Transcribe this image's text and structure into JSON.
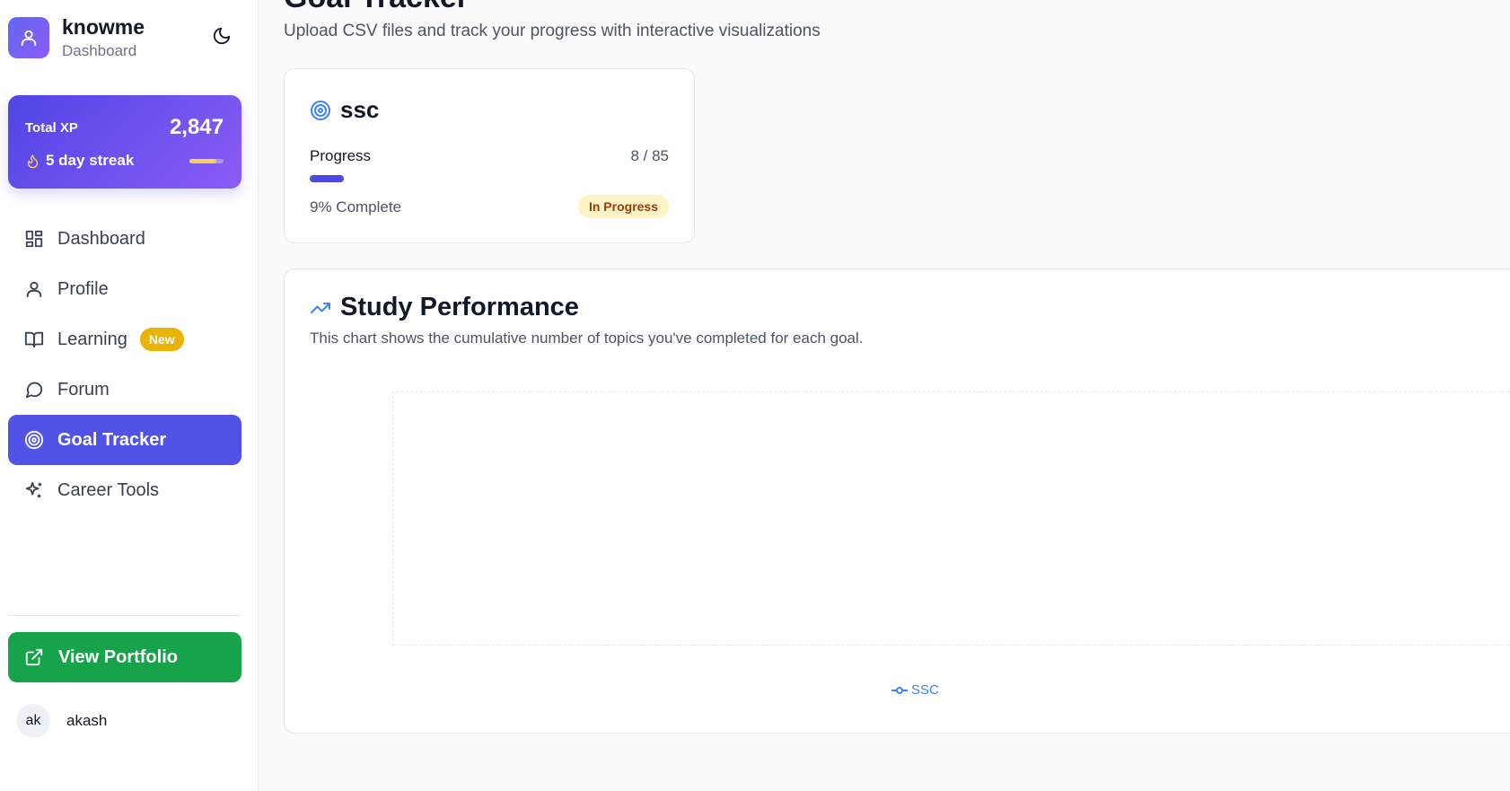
{
  "sidebar": {
    "brand": {
      "title": "knowme",
      "subtitle": "Dashboard",
      "logo_icon": "user-icon"
    },
    "theme_toggle_icon": "moon-icon",
    "xp": {
      "label": "Total XP",
      "value": "2,847",
      "streak": "5 day streak",
      "streak_level": 0.8
    },
    "nav": [
      {
        "label": "Dashboard",
        "icon": "dashboard-grid-icon",
        "active": false
      },
      {
        "label": "Profile",
        "icon": "user-icon",
        "active": false
      },
      {
        "label": "Learning",
        "icon": "book-open-icon",
        "active": false,
        "badge": "New"
      },
      {
        "label": "Forum",
        "icon": "message-circle-icon",
        "active": false
      },
      {
        "label": "Goal Tracker",
        "icon": "target-icon",
        "active": true
      },
      {
        "label": "Career Tools",
        "icon": "sparkles-icon",
        "active": false
      }
    ],
    "portfolio_button": "View Portfolio",
    "user": {
      "initials": "ak",
      "name": "akash"
    }
  },
  "main": {
    "title_partial": "Goal Tracker",
    "subtitle": "Upload CSV files and track your progress with interactive visualizations",
    "goal": {
      "name": "ssc",
      "progress_label": "Progress",
      "progress_count": "8 / 85",
      "progress_fraction": 0.094,
      "percent_text": "9% Complete",
      "status": "In Progress"
    },
    "chart": {
      "title": "Study Performance",
      "description": "This chart shows the cumulative number of topics you've completed for each goal."
    }
  },
  "chart_data": {
    "type": "line",
    "series": [
      {
        "name": "SSC",
        "values": []
      }
    ],
    "legend": "bottom-center",
    "grid": true,
    "colors": {
      "SSC": "#3b82f6"
    }
  },
  "colors": {
    "accent": "#5053e6",
    "portfolio_green": "#16a34a",
    "badge_new": "#eab308",
    "status_bg": "#fef3c7"
  }
}
